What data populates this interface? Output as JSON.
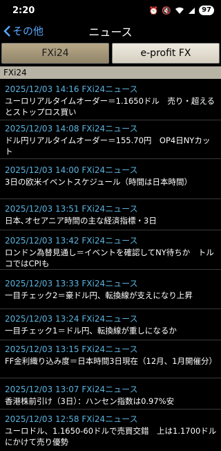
{
  "status": {
    "time": "2:20",
    "battery": "97"
  },
  "nav": {
    "back_label": "その他",
    "title": "ニュース"
  },
  "tabs": [
    {
      "label": "FXi24",
      "active": true
    },
    {
      "label": "e-profit FX",
      "active": false
    }
  ],
  "section_header": "FXi24",
  "news": [
    {
      "meta": "2025/12/03 14:16 FXi24ニュース",
      "headline": "ユーロリアルタイムオーダー＝1.1650ドル　売り・超えるとストップロス買い"
    },
    {
      "meta": "2025/12/03 14:08 FXi24ニュース",
      "headline": "ドル円リアルタイムオーダー＝155.70円　OP4日NYカット"
    },
    {
      "meta": "2025/12/03 14:00 FXi24ニュース",
      "headline": "3日の欧米イベントスケジュール（時間は日本時間）"
    },
    {
      "meta": "2025/12/03 13:51 FXi24ニュース",
      "headline": "日本､オセアニア時間の主な経済指標・3日"
    },
    {
      "meta": "2025/12/03 13:42 FXi24ニュース",
      "headline": "ロンドン為替見通し＝イベントを確認してNY待ちか　トルコではCPIも"
    },
    {
      "meta": "2025/12/03 13:33 FXi24ニュース",
      "headline": "一目チェック2＝豪ドル円、転換線が支えになり上昇"
    },
    {
      "meta": "2025/12/03 13:24 FXi24ニュース",
      "headline": "一目チェック1＝ドル円、転換線が重しになるか"
    },
    {
      "meta": "2025/12/03 13:15 FXi24ニュース",
      "headline": "FF金利織り込み度＝日本時間3日現在（12月、1月開催分）"
    },
    {
      "meta": "2025/12/03 13:07 FXi24ニュース",
      "headline": "香港株前引け（3日）：ハンセン指数は0.97%安"
    },
    {
      "meta": "2025/12/03 12:58 FXi24ニュース",
      "headline": "ユーロドル、1.1650-60ドルで売買交錯　上は1.1700ドルにかけて売り優勢"
    }
  ]
}
